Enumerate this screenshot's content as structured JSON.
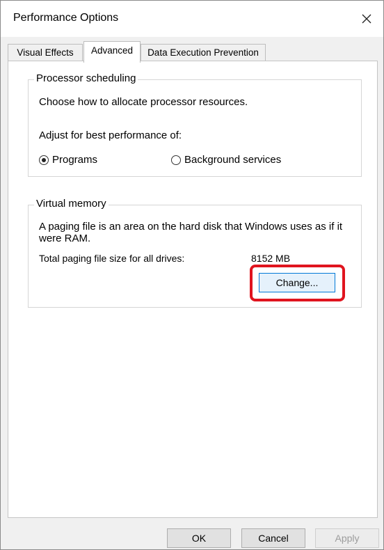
{
  "window": {
    "title": "Performance Options",
    "close_icon": "close-icon"
  },
  "tabs": [
    {
      "label": "Visual Effects",
      "active": false
    },
    {
      "label": "Advanced",
      "active": true
    },
    {
      "label": "Data Execution Prevention",
      "active": false
    }
  ],
  "processor_scheduling": {
    "group_label": "Processor scheduling",
    "description": "Choose how to allocate processor resources.",
    "adjust_label": "Adjust for best performance of:",
    "options": [
      {
        "label": "Programs",
        "selected": true
      },
      {
        "label": "Background services",
        "selected": false
      }
    ]
  },
  "virtual_memory": {
    "group_label": "Virtual memory",
    "description_line1": "A paging file is an area on the hard disk that Windows uses as if it",
    "description_line2": "were RAM.",
    "total_label": "Total paging file size for all drives:",
    "total_value": "8152 MB",
    "change_button": "Change..."
  },
  "footer": {
    "ok": "OK",
    "cancel": "Cancel",
    "apply": "Apply",
    "apply_enabled": false
  },
  "colors": {
    "highlight": "#e0141e",
    "accent": "#0078d7"
  }
}
